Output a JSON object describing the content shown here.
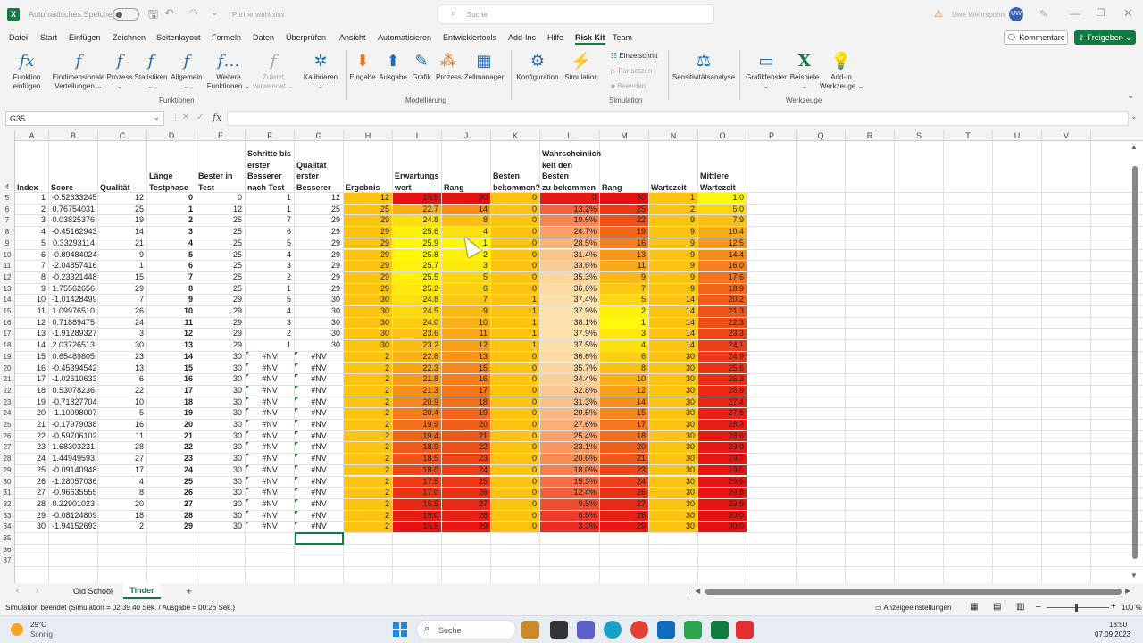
{
  "title": {
    "autosave": "Automatisches Speichern",
    "filename": "Partnerwahl.xlsx",
    "search": "Suche",
    "user": "Uwe Wehrspohn",
    "initials": "UW"
  },
  "menu": [
    "Datei",
    "Start",
    "Einfügen",
    "Zeichnen",
    "Seitenlayout",
    "Formeln",
    "Daten",
    "Überprüfen",
    "Ansicht",
    "Automatisieren",
    "Entwicklertools",
    "Add-Ins",
    "Hilfe",
    "Risk Kit",
    "Team"
  ],
  "buttons": {
    "comments": "Kommentare",
    "share": "Freigeben"
  },
  "ribbon": {
    "funktionen": [
      {
        "icon": "fx",
        "label": "Funktion\neinfügen",
        "c": "#1f6fb3"
      },
      {
        "icon": "f",
        "label": "Eindimensionale\nVerteilungen ⌄",
        "c": "#1f6fb3"
      },
      {
        "icon": "f",
        "label": "Prozess\n⌄",
        "c": "#1f6fb3"
      },
      {
        "icon": "f",
        "label": "Statistiken\n⌄",
        "c": "#1f6fb3"
      },
      {
        "icon": "f",
        "label": "Allgemein\n⌄",
        "c": "#1f6fb3"
      },
      {
        "icon": "f…",
        "label": "Weitere\nFunktionen ⌄",
        "c": "#1f6fb3"
      },
      {
        "icon": "f",
        "label": "Zuletzt\nverwendet ⌄",
        "c": "#aaa"
      },
      {
        "icon": "✲",
        "label": "Kalibrieren\n⌄",
        "c": "#1f6fb3"
      }
    ],
    "modell": [
      {
        "icon": "⬇",
        "label": "Eingabe",
        "c": "#e5771e"
      },
      {
        "icon": "⬆",
        "label": "Ausgabe",
        "c": "#1f6fb3"
      },
      {
        "icon": "✎",
        "label": "Grafik",
        "c": "#1f6fb3"
      },
      {
        "icon": "⁂",
        "label": "Prozess",
        "c": "#e5771e"
      },
      {
        "icon": "▦",
        "label": "Zellmanager",
        "c": "#1f6fb3"
      }
    ],
    "simulation": [
      {
        "icon": "⚙",
        "label": "Konfiguration",
        "c": "#1f6fb3"
      },
      {
        "icon": "⚡",
        "label": "Simulation",
        "c": "#e5771e"
      }
    ],
    "sim_small": [
      "Einzelschritt",
      "Fortsetzen",
      "Beenden"
    ],
    "sens": {
      "icon": "⚖",
      "label": "Sensitivitätsanalyse"
    },
    "werkzeuge": [
      {
        "icon": "▭",
        "label": "Grafikfenster\n⌄",
        "c": "#1f6fb3"
      },
      {
        "icon": "X",
        "label": "Beispiele\n⌄",
        "c": "#107c41"
      },
      {
        "icon": "💡",
        "label": "Add-In\nWerkzeuge ⌄",
        "c": "#e5771e"
      }
    ],
    "groups": [
      "Funktionen",
      "Modellierung",
      "Simulation",
      "Werkzeuge"
    ]
  },
  "formula": {
    "namebox": "G35",
    "content": ""
  },
  "columns": [
    "A",
    "B",
    "C",
    "D",
    "E",
    "F",
    "G",
    "H",
    "I",
    "J",
    "K",
    "L",
    "M",
    "N",
    "O",
    "P",
    "Q",
    "R",
    "S",
    "T",
    "U",
    "V"
  ],
  "headers": {
    "A": "Index",
    "B": "Score",
    "C": "Qualität",
    "D": "Länge\nTestphase",
    "E": "Bester in\nTest",
    "F": "Schritte bis\nerster\nBesserer\nnach Test",
    "G": "Qualität\nerster\nBesserer",
    "H": "Ergebnis",
    "I": "Erwartungs\nwert",
    "J": "Rang",
    "K": "Besten\nbekommen?",
    "L": "Wahrscheinlich\nkeit den Besten\nzu bekommen",
    "M": "Rang",
    "N": "Wartezeit",
    "O": "Mittlere\nWartezeit"
  },
  "rows": [
    [
      "1",
      "-0.52633245",
      "12",
      "0",
      "0",
      "1",
      "12",
      "12",
      "15.5",
      "30",
      "0",
      "0",
      "30",
      "1",
      "1.0"
    ],
    [
      "2",
      "0.76754031",
      "25",
      "1",
      "12",
      "1",
      "25",
      "25",
      "22.7",
      "14",
      "0",
      "13.2%",
      "25",
      "2",
      "5.0"
    ],
    [
      "3",
      "0.03825376",
      "19",
      "2",
      "25",
      "7",
      "29",
      "29",
      "24.8",
      "8",
      "0",
      "19.6%",
      "22",
      "9",
      "7.9"
    ],
    [
      "4",
      "-0.45162943",
      "14",
      "3",
      "25",
      "6",
      "29",
      "29",
      "25.6",
      "4",
      "0",
      "24.7%",
      "19",
      "9",
      "10.4"
    ],
    [
      "5",
      "0.33293114",
      "21",
      "4",
      "25",
      "5",
      "29",
      "29",
      "25.9",
      "1",
      "0",
      "28.5%",
      "16",
      "9",
      "12.5"
    ],
    [
      "6",
      "-0.89484024",
      "9",
      "5",
      "25",
      "4",
      "29",
      "29",
      "25.8",
      "2",
      "0",
      "31.4%",
      "13",
      "9",
      "14.4"
    ],
    [
      "7",
      "-2.04857416",
      "1",
      "6",
      "25",
      "3",
      "29",
      "29",
      "25.7",
      "3",
      "0",
      "33.6%",
      "11",
      "9",
      "16.0"
    ],
    [
      "8",
      "-0.23321448",
      "15",
      "7",
      "25",
      "2",
      "29",
      "29",
      "25.5",
      "5",
      "0",
      "35.3%",
      "9",
      "9",
      "17.6"
    ],
    [
      "9",
      "1.75562656",
      "29",
      "8",
      "25",
      "1",
      "29",
      "29",
      "25.2",
      "6",
      "0",
      "36.6%",
      "7",
      "9",
      "18.9"
    ],
    [
      "10",
      "-1.01428499",
      "7",
      "9",
      "29",
      "5",
      "30",
      "30",
      "24.8",
      "7",
      "1",
      "37.4%",
      "5",
      "14",
      "20.2"
    ],
    [
      "11",
      "1.09976510",
      "26",
      "10",
      "29",
      "4",
      "30",
      "30",
      "24.5",
      "9",
      "1",
      "37.9%",
      "2",
      "14",
      "21.3"
    ],
    [
      "12",
      "0.71889475",
      "24",
      "11",
      "29",
      "3",
      "30",
      "30",
      "24.0",
      "10",
      "1",
      "38.1%",
      "1",
      "14",
      "22.3"
    ],
    [
      "13",
      "-1.91289327",
      "3",
      "12",
      "29",
      "2",
      "30",
      "30",
      "23.6",
      "11",
      "1",
      "37.9%",
      "3",
      "14",
      "23.3"
    ],
    [
      "14",
      "2.03726513",
      "30",
      "13",
      "29",
      "1",
      "30",
      "30",
      "23.2",
      "12",
      "1",
      "37.5%",
      "4",
      "14",
      "24.1"
    ],
    [
      "15",
      "0.65489805",
      "23",
      "14",
      "30",
      "#NV",
      "#NV",
      "2",
      "22.8",
      "13",
      "0",
      "36.6%",
      "6",
      "30",
      "24.9"
    ],
    [
      "16",
      "-0.45394542",
      "13",
      "15",
      "30",
      "#NV",
      "#NV",
      "2",
      "22.3",
      "15",
      "0",
      "35.7%",
      "8",
      "30",
      "25.6"
    ],
    [
      "17",
      "-1.02610633",
      "6",
      "16",
      "30",
      "#NV",
      "#NV",
      "2",
      "21.8",
      "16",
      "0",
      "34.4%",
      "10",
      "30",
      "26.3"
    ],
    [
      "18",
      "0.53078236",
      "22",
      "17",
      "30",
      "#NV",
      "#NV",
      "2",
      "21.3",
      "17",
      "0",
      "32.8%",
      "12",
      "30",
      "26.9"
    ],
    [
      "19",
      "-0.71827704",
      "10",
      "18",
      "30",
      "#NV",
      "#NV",
      "2",
      "20.9",
      "18",
      "0",
      "31.3%",
      "14",
      "30",
      "27.4"
    ],
    [
      "20",
      "-1.10098007",
      "5",
      "19",
      "30",
      "#NV",
      "#NV",
      "2",
      "20.4",
      "19",
      "0",
      "29.5%",
      "15",
      "30",
      "27.8"
    ],
    [
      "21",
      "-0.17979038",
      "16",
      "20",
      "30",
      "#NV",
      "#NV",
      "2",
      "19.9",
      "20",
      "0",
      "27.6%",
      "17",
      "30",
      "28.3"
    ],
    [
      "22",
      "-0.59706102",
      "11",
      "21",
      "30",
      "#NV",
      "#NV",
      "2",
      "19.4",
      "21",
      "0",
      "25.4%",
      "18",
      "30",
      "28.6"
    ],
    [
      "23",
      "1.68303231",
      "28",
      "22",
      "30",
      "#NV",
      "#NV",
      "2",
      "18.9",
      "22",
      "0",
      "23.1%",
      "20",
      "30",
      "29.0"
    ],
    [
      "24",
      "1.44949593",
      "27",
      "23",
      "30",
      "#NV",
      "#NV",
      "2",
      "18.5",
      "23",
      "0",
      "20.6%",
      "21",
      "30",
      "29.2"
    ],
    [
      "25",
      "-0.09140948",
      "17",
      "24",
      "30",
      "#NV",
      "#NV",
      "2",
      "18.0",
      "24",
      "0",
      "18.0%",
      "23",
      "30",
      "29.5"
    ],
    [
      "26",
      "-1.28057036",
      "4",
      "25",
      "30",
      "#NV",
      "#NV",
      "2",
      "17.5",
      "25",
      "0",
      "15.3%",
      "24",
      "30",
      "29.6"
    ],
    [
      "27",
      "-0.96635555",
      "8",
      "26",
      "30",
      "#NV",
      "#NV",
      "2",
      "17.0",
      "26",
      "0",
      "12.4%",
      "26",
      "30",
      "29.8"
    ],
    [
      "28",
      "0.22901023",
      "20",
      "27",
      "30",
      "#NV",
      "#NV",
      "2",
      "16.5",
      "27",
      "0",
      "9.5%",
      "27",
      "30",
      "29.9"
    ],
    [
      "29",
      "-0.08124809",
      "18",
      "28",
      "30",
      "#NV",
      "#NV",
      "2",
      "16.0",
      "28",
      "0",
      "6.5%",
      "28",
      "30",
      "30.0"
    ],
    [
      "30",
      "-1.94152693",
      "2",
      "29",
      "30",
      "#NV",
      "#NV",
      "2",
      "15.5",
      "29",
      "0",
      "3.3%",
      "29",
      "30",
      "30.0"
    ]
  ],
  "colors": {
    "gold": "#fcc411",
    "grid": "#e1e1e1",
    "selection": "#107c41",
    "excel_green": "#107c41",
    "accent_blue": "#1f6fb3"
  },
  "sheets": [
    "Old School",
    "Tinder"
  ],
  "status": {
    "text": "Simulation beendet (Simulation = 02:39.40 Sek. / Ausgabe = 00:26 Sek.)",
    "display_settings": "Anzeigeeinstellungen",
    "zoom": "100 %"
  },
  "taskbar": {
    "temp": "29°C",
    "weather": "Sonnig",
    "search": "Suche",
    "time": "18:50",
    "date": "07.09.2023"
  }
}
